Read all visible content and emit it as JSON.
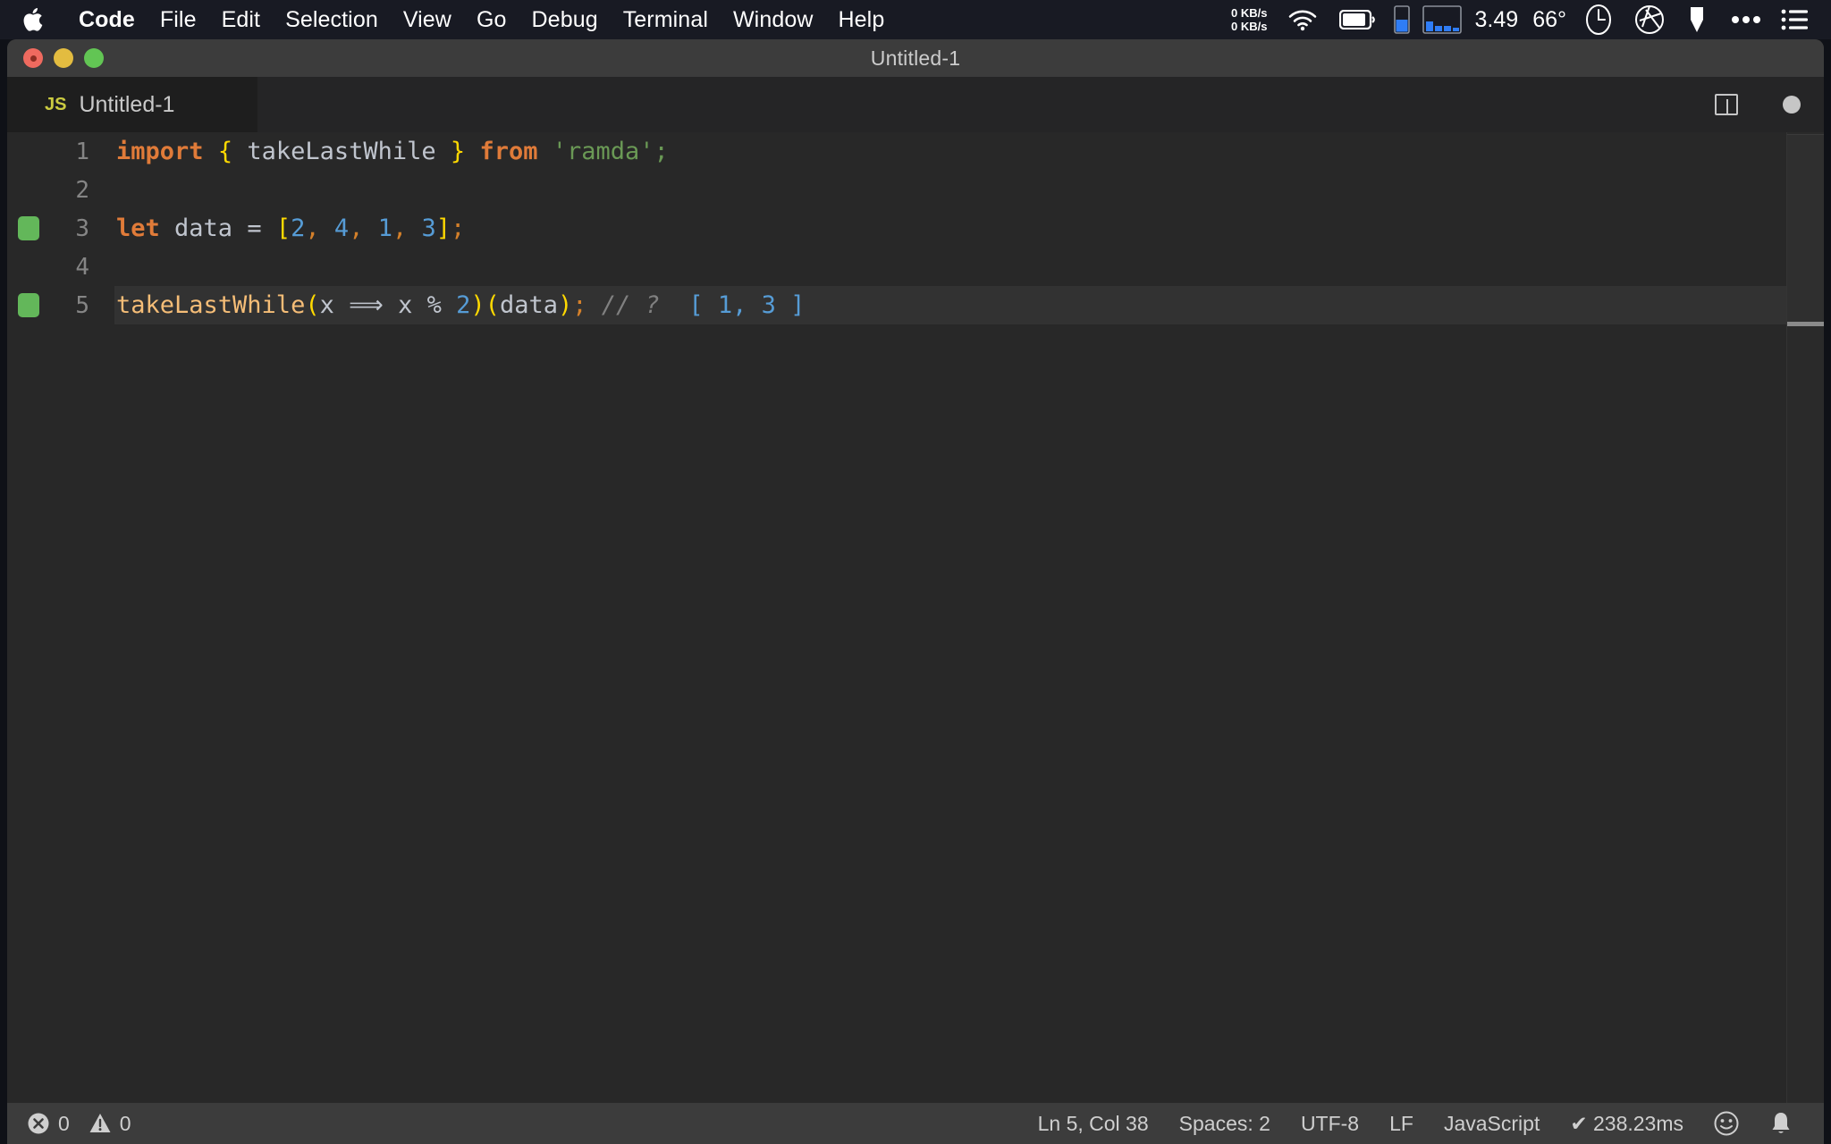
{
  "menubar": {
    "apple_icon": "apple-logo-icon",
    "items": [
      {
        "label": "Code",
        "bold": true
      },
      {
        "label": "File",
        "bold": false
      },
      {
        "label": "Edit",
        "bold": false
      },
      {
        "label": "Selection",
        "bold": false
      },
      {
        "label": "View",
        "bold": false
      },
      {
        "label": "Go",
        "bold": false
      },
      {
        "label": "Debug",
        "bold": false
      },
      {
        "label": "Terminal",
        "bold": false
      },
      {
        "label": "Window",
        "bold": false
      },
      {
        "label": "Help",
        "bold": false
      }
    ],
    "status": {
      "net_up": "0 KB/s",
      "net_down": "0 KB/s",
      "wifi_icon": "wifi-icon",
      "battery_icon": "battery-icon",
      "memory_icon": "memory-gauge-icon",
      "cpu_history_icon": "cpu-history-icon",
      "load_average": "3.49",
      "temperature": "66°",
      "clock_icon": "clock-icon",
      "aperture_icon": "aperture-icon",
      "dropbox_icon": "dropbox-icon",
      "more_icon": "ellipsis-icon",
      "control_center_icon": "list-menu-icon"
    }
  },
  "window": {
    "title": "Untitled-1",
    "traffic_lights": [
      "close",
      "minimize",
      "zoom"
    ]
  },
  "tabbar": {
    "tab_icon_label": "JS",
    "tab_label": "Untitled-1",
    "split_editor_icon": "split-editor-icon",
    "dirty_indicator": "unsaved-dot-icon"
  },
  "editor": {
    "lines": [
      {
        "number": "1",
        "marker": null,
        "current": false,
        "tokens": [
          {
            "text": "import",
            "cls": "t-kw"
          },
          {
            "text": " ",
            "cls": "t-op"
          },
          {
            "text": "{",
            "cls": "t-brace"
          },
          {
            "text": " takeLastWhile ",
            "cls": "t-ident"
          },
          {
            "text": "}",
            "cls": "t-brace"
          },
          {
            "text": " ",
            "cls": "t-op"
          },
          {
            "text": "from",
            "cls": "t-kw"
          },
          {
            "text": " ",
            "cls": "t-op"
          },
          {
            "text": "'ramda'",
            "cls": "t-string"
          },
          {
            "text": ";",
            "cls": "t-string"
          }
        ]
      },
      {
        "number": "2",
        "marker": null,
        "current": false,
        "tokens": []
      },
      {
        "number": "3",
        "marker": "green",
        "current": false,
        "tokens": [
          {
            "text": "let",
            "cls": "t-kw"
          },
          {
            "text": " data ",
            "cls": "t-var"
          },
          {
            "text": "=",
            "cls": "t-op"
          },
          {
            "text": " ",
            "cls": "t-op"
          },
          {
            "text": "[",
            "cls": "t-brace"
          },
          {
            "text": "2",
            "cls": "t-num"
          },
          {
            "text": ",",
            "cls": "t-punct"
          },
          {
            "text": " ",
            "cls": "t-op"
          },
          {
            "text": "4",
            "cls": "t-num"
          },
          {
            "text": ",",
            "cls": "t-punct"
          },
          {
            "text": " ",
            "cls": "t-op"
          },
          {
            "text": "1",
            "cls": "t-num"
          },
          {
            "text": ",",
            "cls": "t-punct"
          },
          {
            "text": " ",
            "cls": "t-op"
          },
          {
            "text": "3",
            "cls": "t-num"
          },
          {
            "text": "]",
            "cls": "t-brace"
          },
          {
            "text": ";",
            "cls": "t-punct"
          }
        ]
      },
      {
        "number": "4",
        "marker": null,
        "current": false,
        "tokens": []
      },
      {
        "number": "5",
        "marker": "green",
        "current": true,
        "tokens": [
          {
            "text": "takeLastWhile",
            "cls": "t-fn"
          },
          {
            "text": "(",
            "cls": "t-paren"
          },
          {
            "text": "x ",
            "cls": "t-var"
          },
          {
            "text": "⟹",
            "cls": "t-arrow"
          },
          {
            "text": " x ",
            "cls": "t-var"
          },
          {
            "text": "%",
            "cls": "t-op"
          },
          {
            "text": " ",
            "cls": "t-op"
          },
          {
            "text": "2",
            "cls": "t-num"
          },
          {
            "text": ")",
            "cls": "t-paren"
          },
          {
            "text": "(",
            "cls": "t-paren"
          },
          {
            "text": "data",
            "cls": "t-var"
          },
          {
            "text": ")",
            "cls": "t-paren"
          },
          {
            "text": ";",
            "cls": "t-punct"
          },
          {
            "text": " ",
            "cls": "t-op"
          },
          {
            "text": "// ?",
            "cls": "t-comment"
          },
          {
            "text": "  ",
            "cls": "t-op"
          },
          {
            "text": "[ 1, 3 ]",
            "cls": "t-quokka"
          }
        ]
      }
    ]
  },
  "statusbar": {
    "errors_icon": "error-circle-icon",
    "errors_count": "0",
    "warnings_icon": "warning-triangle-icon",
    "warnings_count": "0",
    "cursor_position": "Ln 5, Col 38",
    "indentation": "Spaces: 2",
    "encoding": "UTF-8",
    "eol": "LF",
    "language": "JavaScript",
    "quokka_status": "✔ 238.23ms",
    "feedback_icon": "smiley-icon",
    "notifications_icon": "bell-icon"
  },
  "colors": {
    "menubar_bg": "#181a23",
    "titlebar_bg": "#3c3c3c",
    "tabbar_bg": "#252526",
    "editor_bg": "#282828",
    "statusbar_bg": "#3c3c3c",
    "marker_green": "#63b75a",
    "accent_blue": "#3b82f6",
    "js_yellow": "#cbcb41"
  }
}
